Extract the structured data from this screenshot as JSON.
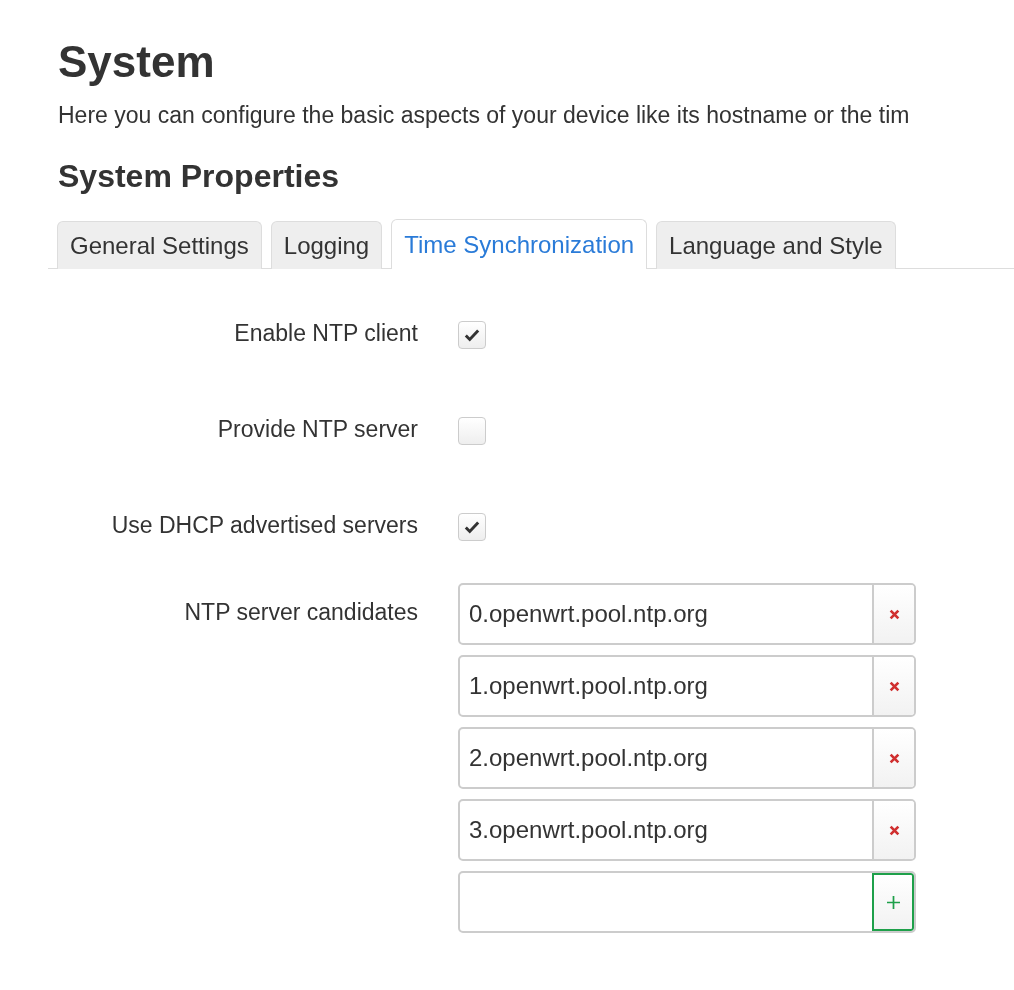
{
  "page": {
    "title": "System",
    "description": "Here you can configure the basic aspects of your device like its hostname or the tim"
  },
  "section": {
    "title": "System Properties"
  },
  "tabs": [
    {
      "label": "General Settings",
      "selected": false
    },
    {
      "label": "Logging",
      "selected": false
    },
    {
      "label": "Time Synchronization",
      "selected": true
    },
    {
      "label": "Language and Style",
      "selected": false
    }
  ],
  "fields": [
    {
      "kind": "checkbox",
      "label": "Enable NTP client",
      "checked": true
    },
    {
      "kind": "checkbox",
      "label": "Provide NTP server",
      "checked": false
    },
    {
      "kind": "checkbox",
      "label": "Use DHCP advertised servers",
      "checked": true
    },
    {
      "kind": "list",
      "label": "NTP server candidates",
      "values": [
        "0.openwrt.pool.ntp.org",
        "1.openwrt.pool.ntp.org",
        "2.openwrt.pool.ntp.org",
        "3.openwrt.pool.ntp.org"
      ]
    }
  ]
}
